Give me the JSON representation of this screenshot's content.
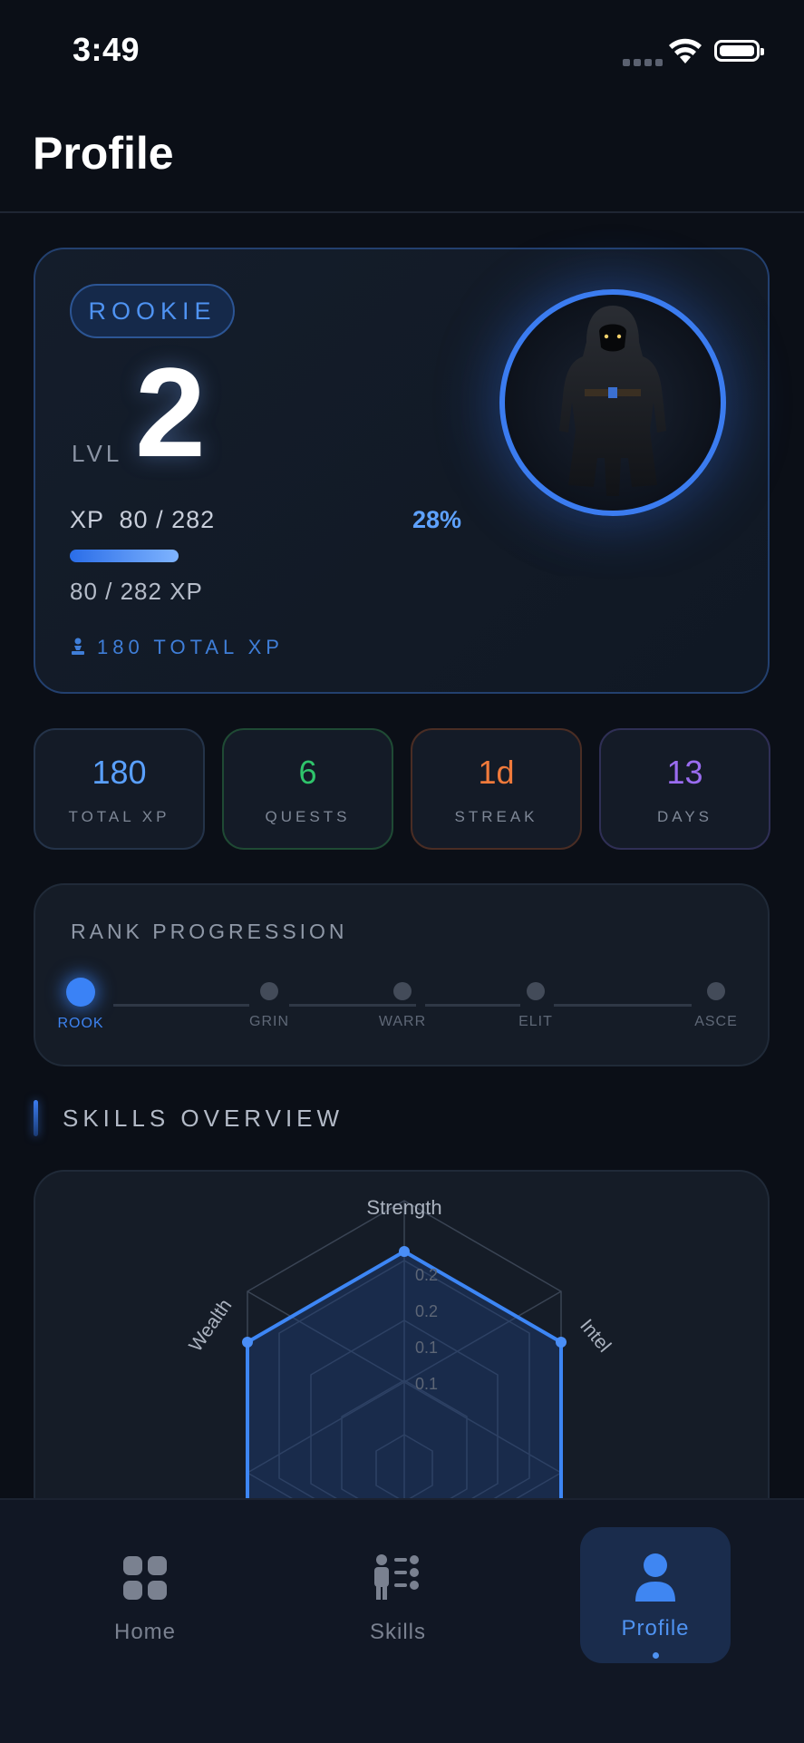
{
  "status_bar": {
    "time": "3:49"
  },
  "header": {
    "title": "Profile"
  },
  "hero": {
    "rank": "ROOKIE",
    "level_label": "LVL",
    "level": "2",
    "xp_text": "XP  80 / 282",
    "xp_percent_label": "28%",
    "xp_progress": 0.28,
    "xp_sub": "80 / 282 XP",
    "total_xp": "180 TOTAL XP"
  },
  "stats": [
    {
      "value": "180",
      "label": "TOTAL XP",
      "color": "#5aa0ff",
      "border": "#243349"
    },
    {
      "value": "6",
      "label": "QUESTS",
      "color": "#2fc46b",
      "border": "#1f4a34"
    },
    {
      "value": "1d",
      "label": "STREAK",
      "color": "#f07a3b",
      "border": "#4a2d24"
    },
    {
      "value": "13",
      "label": "DAYS",
      "color": "#9a6cf0",
      "border": "#2f2f55"
    }
  ],
  "rank_progression": {
    "title": "RANK PROGRESSION",
    "ranks": [
      "ROOK",
      "GRIN",
      "WARR",
      "ELIT",
      "ASCE"
    ],
    "current_index": 0
  },
  "skills_overview": {
    "title": "SKILLS OVERVIEW",
    "axes": [
      "Strength",
      "Intel",
      "Wealth"
    ],
    "ring_labels": [
      "0.2",
      "0.2",
      "0.1",
      "0.1"
    ]
  },
  "tabbar": {
    "items": [
      {
        "label": "Home",
        "icon": "home-grid-icon"
      },
      {
        "label": "Skills",
        "icon": "skills-list-icon"
      },
      {
        "label": "Profile",
        "icon": "person-icon"
      }
    ],
    "active_index": 2
  },
  "colors": {
    "accent": "#3b7cf0",
    "background": "#0b0f17",
    "card": "#151c27"
  }
}
